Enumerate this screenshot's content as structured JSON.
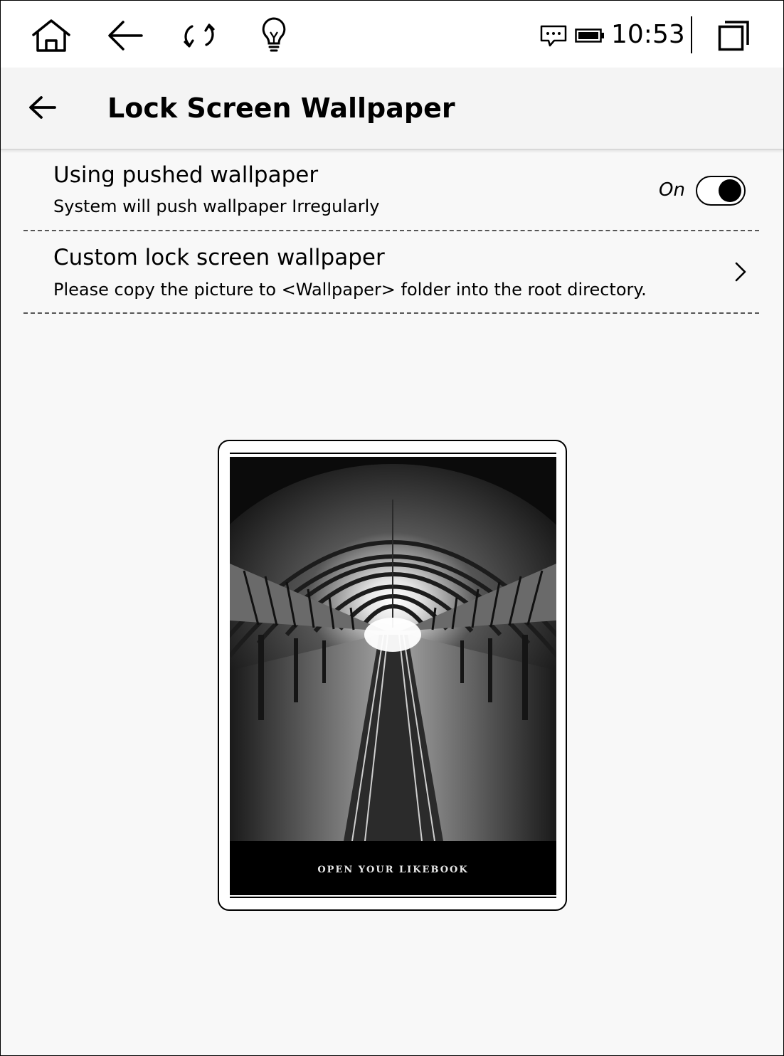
{
  "status_bar": {
    "time": "10:53",
    "icons": [
      "home-icon",
      "back-arrow-icon",
      "refresh-icon",
      "lightbulb-icon",
      "message-icon",
      "battery-icon",
      "window-icon"
    ]
  },
  "header": {
    "title": "Lock Screen Wallpaper",
    "back_icon": "arrow-left-icon"
  },
  "settings": {
    "pushed_wallpaper": {
      "title": "Using pushed wallpaper",
      "subtitle": "System will push wallpaper Irregularly",
      "state_label": "On",
      "enabled": true
    },
    "custom_wallpaper": {
      "title": "Custom lock screen wallpaper",
      "subtitle": "Please copy the picture to <Wallpaper> folder into the root directory.",
      "icon": "chevron-right-icon"
    }
  },
  "preview": {
    "caption": "OPEN YOUR LIKEBOOK",
    "image": "train station platform wallpaper"
  }
}
